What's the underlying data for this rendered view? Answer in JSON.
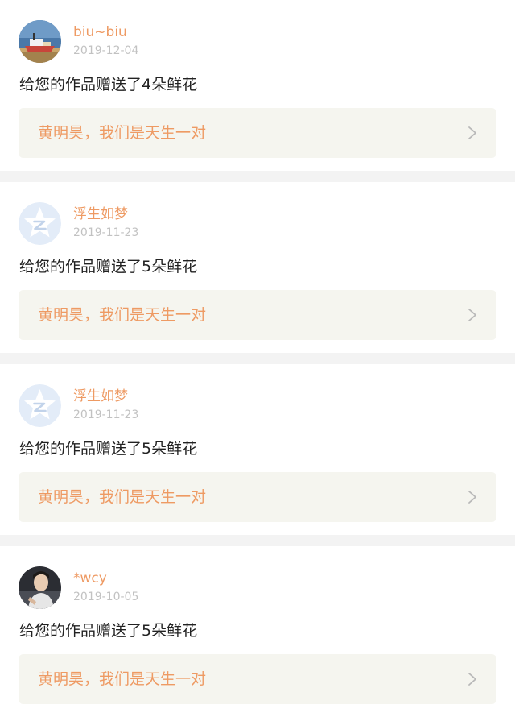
{
  "notifications": [
    {
      "username": "biu~biu",
      "date": "2019-12-04",
      "message": "给您的作品赠送了4朵鲜花",
      "work_title": "黄明昊，我们是天生一对",
      "avatar": "boat-photo-avatar"
    },
    {
      "username": "浮生如梦",
      "date": "2019-11-23",
      "message": "给您的作品赠送了5朵鲜花",
      "work_title": "黄明昊，我们是天生一对",
      "avatar": "qzone-default-avatar"
    },
    {
      "username": "浮生如梦",
      "date": "2019-11-23",
      "message": "给您的作品赠送了5朵鲜花",
      "work_title": "黄明昊，我们是天生一对",
      "avatar": "qzone-default-avatar"
    },
    {
      "username": "*wcy",
      "date": "2019-10-05",
      "message": "给您的作品赠送了5朵鲜花",
      "work_title": "黄明昊，我们是天生一对",
      "avatar": "person-photo-avatar"
    }
  ],
  "colors": {
    "accent": "#ee9a63",
    "date": "#c2c2c2",
    "message": "#222222",
    "link_bg": "#f5f5ef",
    "page_bg": "#f3f3f3"
  }
}
